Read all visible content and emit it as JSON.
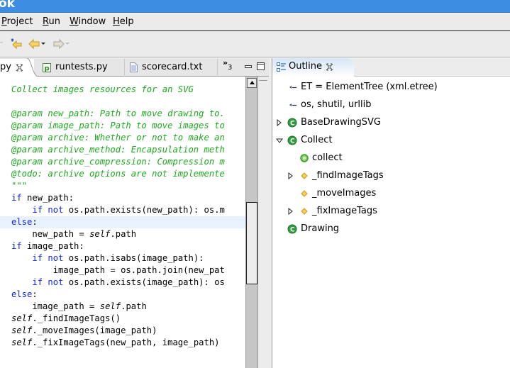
{
  "window": {
    "title": "ok"
  },
  "menu": [
    {
      "label": "Project",
      "mnemonic": "P",
      "rest": "roject"
    },
    {
      "label": "Run",
      "mnemonic": "R",
      "rest": "un"
    },
    {
      "label": "Window",
      "mnemonic": "W",
      "rest": "indow"
    },
    {
      "label": "Help",
      "mnemonic": "H",
      "rest": "elp"
    }
  ],
  "toolbar": {
    "icons": [
      "last-edit-location-icon",
      "back-icon",
      "forward-icon"
    ]
  },
  "editor": {
    "tabs": [
      {
        "label": "py",
        "icon": "python-file-icon",
        "active": true,
        "closable": true
      },
      {
        "label": "runtests.py",
        "icon": "pydev-file-icon",
        "active": false
      },
      {
        "label": "scorecard.txt",
        "icon": "text-file-icon",
        "active": false
      }
    ],
    "overflow_count": "3",
    "overflow_glyph": "»",
    "code_lines": [
      {
        "type": "comment",
        "text": "\"\"\""
      },
      {
        "type": "comment",
        "text": "Collect images resources for an SVG"
      },
      {
        "type": "blank",
        "text": ""
      },
      {
        "type": "comment",
        "text": "@param new_path: Path to move drawing to."
      },
      {
        "type": "comment",
        "text": "@param image_path: Path to move images to"
      },
      {
        "type": "comment",
        "text": "@param archive: Whether or not to make an"
      },
      {
        "type": "comment",
        "text": "@param archive_method: Encapsulation meth"
      },
      {
        "type": "comment",
        "text": "@param archive_compression: Compression m"
      },
      {
        "type": "comment",
        "text": "@todo: archive options are not implemente"
      },
      {
        "type": "comment",
        "text": "\"\"\""
      },
      {
        "type": "code",
        "text": "if new_path:"
      },
      {
        "type": "code",
        "text": "    if not os.path.exists(new_path): os.m"
      },
      {
        "type": "code",
        "text": "else:",
        "highlighted": true
      },
      {
        "type": "code",
        "text": "    new_path = self.path"
      },
      {
        "type": "code",
        "text": "if image_path:"
      },
      {
        "type": "code",
        "text": "    if not os.path.isabs(image_path):"
      },
      {
        "type": "code",
        "text": "        image_path = os.path.join(new_pat"
      },
      {
        "type": "code",
        "text": "    if not os.path.exists(image_path): os"
      },
      {
        "type": "code",
        "text": "else:"
      },
      {
        "type": "code",
        "text": "    image_path = self.path"
      },
      {
        "type": "code",
        "text": "self._findImageTags()"
      },
      {
        "type": "code",
        "text": "self._moveImages(image_path)"
      },
      {
        "type": "code",
        "text": "self._fixImageTags(new_path, image_path)"
      }
    ]
  },
  "outline": {
    "tab_label": "Outline",
    "nodes": [
      {
        "label": "ET = ElementTree (xml.etree)",
        "icon": "import-icon",
        "depth": 0,
        "twisty": "none"
      },
      {
        "label": "os, shutil, urllib",
        "icon": "import-icon",
        "depth": 0,
        "twisty": "none"
      },
      {
        "label": "BaseDrawingSVG",
        "icon": "class-icon",
        "depth": 0,
        "twisty": "collapsed"
      },
      {
        "label": "Collect",
        "icon": "class-icon",
        "depth": 0,
        "twisty": "expanded"
      },
      {
        "label": "collect",
        "icon": "public-method-icon",
        "depth": 1,
        "twisty": "none"
      },
      {
        "label": "_findImageTags",
        "icon": "protected-method-icon",
        "depth": 1,
        "twisty": "collapsed"
      },
      {
        "label": "_moveImages",
        "icon": "protected-method-icon",
        "depth": 1,
        "twisty": "none"
      },
      {
        "label": "_fixImageTags",
        "icon": "protected-method-icon",
        "depth": 1,
        "twisty": "collapsed"
      },
      {
        "label": "Drawing",
        "icon": "class-icon",
        "depth": 0,
        "twisty": "none"
      }
    ]
  },
  "colors": {
    "titlebar": "#3c8ee3",
    "comment": "#1fa81f",
    "keyword": "#1428d8",
    "current_line": "#e8f2fe",
    "class_icon": "#2e9e3e",
    "method_icon": "#f2c04a"
  }
}
